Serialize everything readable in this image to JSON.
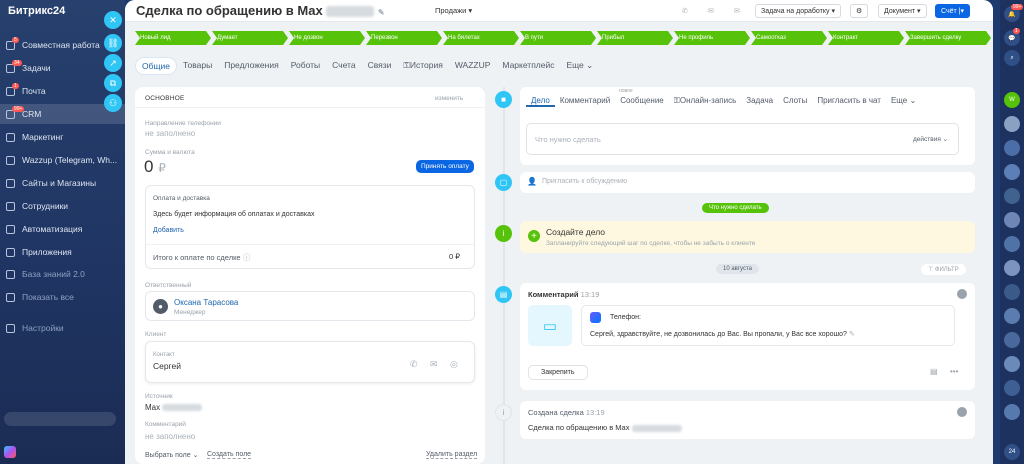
{
  "nav": {
    "brand": "Битрикс24",
    "items": [
      {
        "label": "Совместная работа",
        "badge": "5"
      },
      {
        "label": "Задачи",
        "badge": "34"
      },
      {
        "label": "Почта",
        "badge": "1"
      },
      {
        "label": "CRM",
        "badge": "99+"
      },
      {
        "label": "Маркетинг",
        "badge": ""
      },
      {
        "label": "Wazzup (Telegram, Wh...",
        "badge": ""
      },
      {
        "label": "Сайты и Магазины",
        "badge": ""
      },
      {
        "label": "Сотрудники",
        "badge": ""
      },
      {
        "label": "Автоматизация",
        "badge": ""
      },
      {
        "label": "Приложения",
        "badge": ""
      },
      {
        "label": "База знаний 2.0",
        "badge": ""
      },
      {
        "label": "Показать все",
        "badge": ""
      },
      {
        "label": "Настройки",
        "badge": ""
      }
    ]
  },
  "header": {
    "title": "Сделка по обращению в Max",
    "pipeline": "Продажи",
    "task_button": "Задача на доработку",
    "document_button": "Документ",
    "invoice_button": "Счёт"
  },
  "stages": [
    "Новый лид",
    "Думает",
    "Не дозвон",
    "Перезвон",
    "На билетах",
    "В пути",
    "Прибыл",
    "Не профиль",
    "Самоотказ",
    "Контракт",
    "Завершить сделку"
  ],
  "tabs": [
    "Общие",
    "Товары",
    "Предложения",
    "Роботы",
    "Счета",
    "Связи",
    "История",
    "WAZZUP",
    "Маркетплейс",
    "Еще"
  ],
  "left": {
    "section_title": "основное",
    "edit_link": "изменить",
    "phone_label": "Направление телефонии",
    "phone_value": "не заполнено",
    "amount_label": "Сумма и валюта",
    "amount_value": "0",
    "currency": "₽",
    "pay_button": "Принять оплату",
    "payment_title": "Оплата и доставка",
    "payment_text": "Здесь будет информация об оплатах и доставках",
    "add_link": "Добавить",
    "total_label": "Итого к оплате по сделке",
    "total_value": "0 ₽",
    "responsible_label": "Ответственный",
    "responsible_name": "Оксана Тарасова",
    "responsible_role": "Менеджер",
    "client_label": "Клиент",
    "contact_label": "Контакт",
    "contact_name": "Сергей",
    "source_label": "Источник",
    "source_value": "Max",
    "comment_label": "Комментарий",
    "comment_value": "не заполнено",
    "select_field": "Выбрать поле",
    "create_field": "Создать поле",
    "delete_section": "Удалить раздел"
  },
  "activity": {
    "tabs": [
      "Дело",
      "Комментарий",
      "Сообщение",
      "Онлайн-запись",
      "Задача",
      "Слоты",
      "Пригласить в чат",
      "Еще"
    ],
    "new_badge": "новое",
    "placeholder": "Что нужно сделать",
    "actions": "действия",
    "invite_placeholder": "Пригласить к обсуждению",
    "todo_pill": "Что нужно сделать",
    "create_title": "Создайте дело",
    "create_text": "Запланируйте следующий шаг по сделке, чтобы не забыть о клиенте",
    "date_pill": "10 августа",
    "filter": "ФИЛЬТР",
    "comment_title": "Комментарий",
    "comment_time": "13:19",
    "phone_title": "Телефон:",
    "message": "Сергей, здравствуйте, не дозвонилась до Вас. Вы пропали, у Вас все хорошо?",
    "pin_button": "Закрепить",
    "created_title": "Создана сделка",
    "created_time": "13:19",
    "created_text": "Сделка по обращению в Max"
  },
  "rail": {
    "badge1": "99+",
    "badge2": "1"
  },
  "colors": {
    "stage": "#57c20a",
    "accent": "#2067b0",
    "primary_btn": "#0b66e4"
  }
}
